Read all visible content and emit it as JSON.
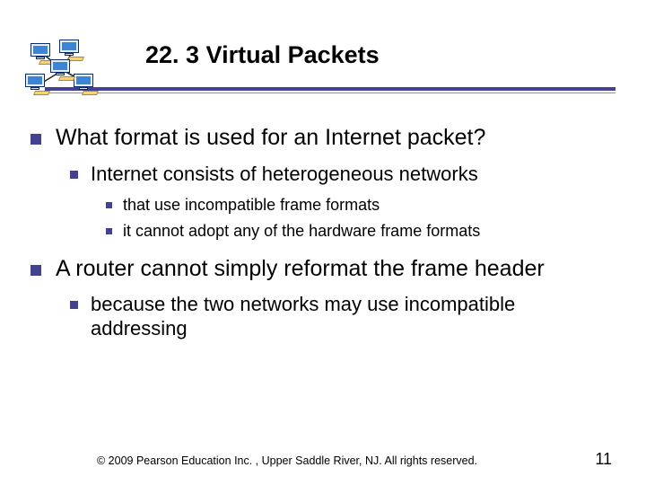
{
  "header": {
    "title": "22. 3  Virtual Packets"
  },
  "content": {
    "items": [
      {
        "label": "What format is used for an Internet packet?",
        "children": [
          {
            "label": "Internet consists of heterogeneous networks",
            "children": [
              {
                "label": "that use incompatible frame formats"
              },
              {
                "label": "it cannot adopt any of the hardware frame formats"
              }
            ]
          }
        ]
      },
      {
        "label": "A router cannot simply reformat the frame header",
        "children": [
          {
            "label": "because the two networks may use incompatible addressing",
            "children": []
          }
        ]
      }
    ]
  },
  "footer": {
    "copyright": "© 2009 Pearson Education Inc. , Upper Saddle River, NJ. All rights reserved.",
    "page": "11"
  },
  "colors": {
    "accent": "#424290",
    "rule2": "#c08a38"
  }
}
